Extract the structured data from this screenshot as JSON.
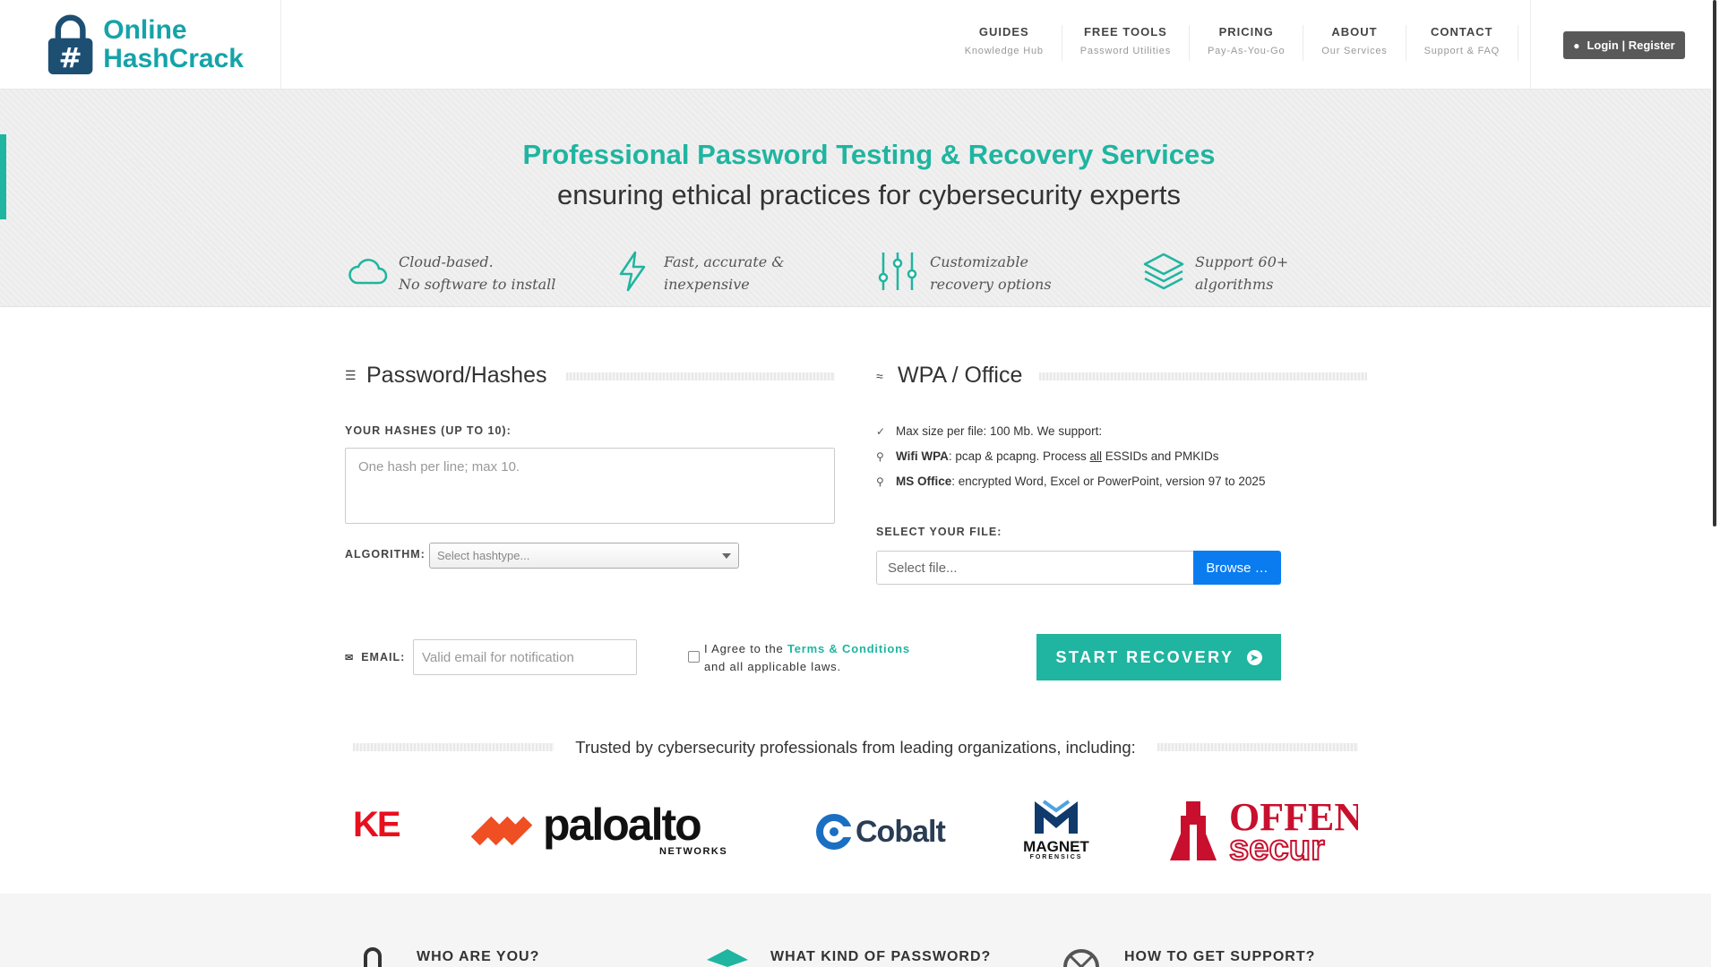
{
  "brand": {
    "line1": "Online",
    "line2": "HashCrack",
    "accent": "#1fb5a0"
  },
  "nav": [
    {
      "title": "GUIDES",
      "sub": "Knowledge Hub"
    },
    {
      "title": "FREE TOOLS",
      "sub": "Password Utilities"
    },
    {
      "title": "PRICING",
      "sub": "Pay-As-You-Go"
    },
    {
      "title": "ABOUT",
      "sub": "Our Services"
    },
    {
      "title": "CONTACT",
      "sub": "Support & FAQ"
    }
  ],
  "login": {
    "label": "Login | Register",
    "icon": "user-icon"
  },
  "hero": {
    "title": "Professional Password Testing & Recovery Services",
    "subtitle": "ensuring ethical practices for cybersecurity experts"
  },
  "features": [
    {
      "icon": "cloud-icon",
      "line1": "Cloud-based.",
      "line2": "No software to install"
    },
    {
      "icon": "bolt-icon",
      "line1": "Fast, accurate &",
      "line2": "inexpensive"
    },
    {
      "icon": "sliders-icon",
      "line1": "Customizable",
      "line2": "recovery options"
    },
    {
      "icon": "layers-icon",
      "line1": "Support 60+",
      "line2": "algorithms"
    }
  ],
  "hashes": {
    "heading": "Password/Hashes",
    "label": "YOUR HASHES (UP TO 10):",
    "placeholder": "One hash per line; max 10.",
    "algorithm_label": "ALGORITHM:",
    "algorithm_selected": "Select hashtype..."
  },
  "wpa": {
    "heading": "WPA / Office",
    "bullet1": "Max size per file: 100 Mb. We support:",
    "bullet2_bold": "Wifi WPA",
    "bullet2_a": ": pcap & pcapng. Process ",
    "bullet2_u": "all",
    "bullet2_b": " ESSIDs and PMKIDs",
    "bullet3_bold": "MS Office",
    "bullet3_rest": ": encrypted Word, Excel or PowerPoint, version 97 to 2025",
    "file_label": "SELECT YOUR FILE:",
    "file_placeholder": "Select file...",
    "browse": "Browse …"
  },
  "form": {
    "email_label": "EMAIL:",
    "email_placeholder": "Valid email for notification",
    "agree_a": "I Agree to the ",
    "agree_link": "Terms & Conditions",
    "agree_b": "and all applicable laws.",
    "start": "START RECOVERY"
  },
  "trusted": "Trusted by cybersecurity professionals from leading organizations, including:",
  "partners": {
    "p1": "KE",
    "p2": "paloalto",
    "p2_sub": "NETWORKS",
    "p3": "Cobalt",
    "p4": "MAGNET",
    "p4_sub": "FORENSICS",
    "p5": "OFFENS",
    "p5_sub": "secur"
  },
  "bottom": [
    {
      "icon": "lock-icon",
      "label": "WHO ARE YOU?"
    },
    {
      "icon": "layers-icon",
      "label": "WHAT KIND OF PASSWORD?"
    },
    {
      "icon": "lifebuoy-icon",
      "label": "HOW TO GET SUPPORT?"
    }
  ]
}
